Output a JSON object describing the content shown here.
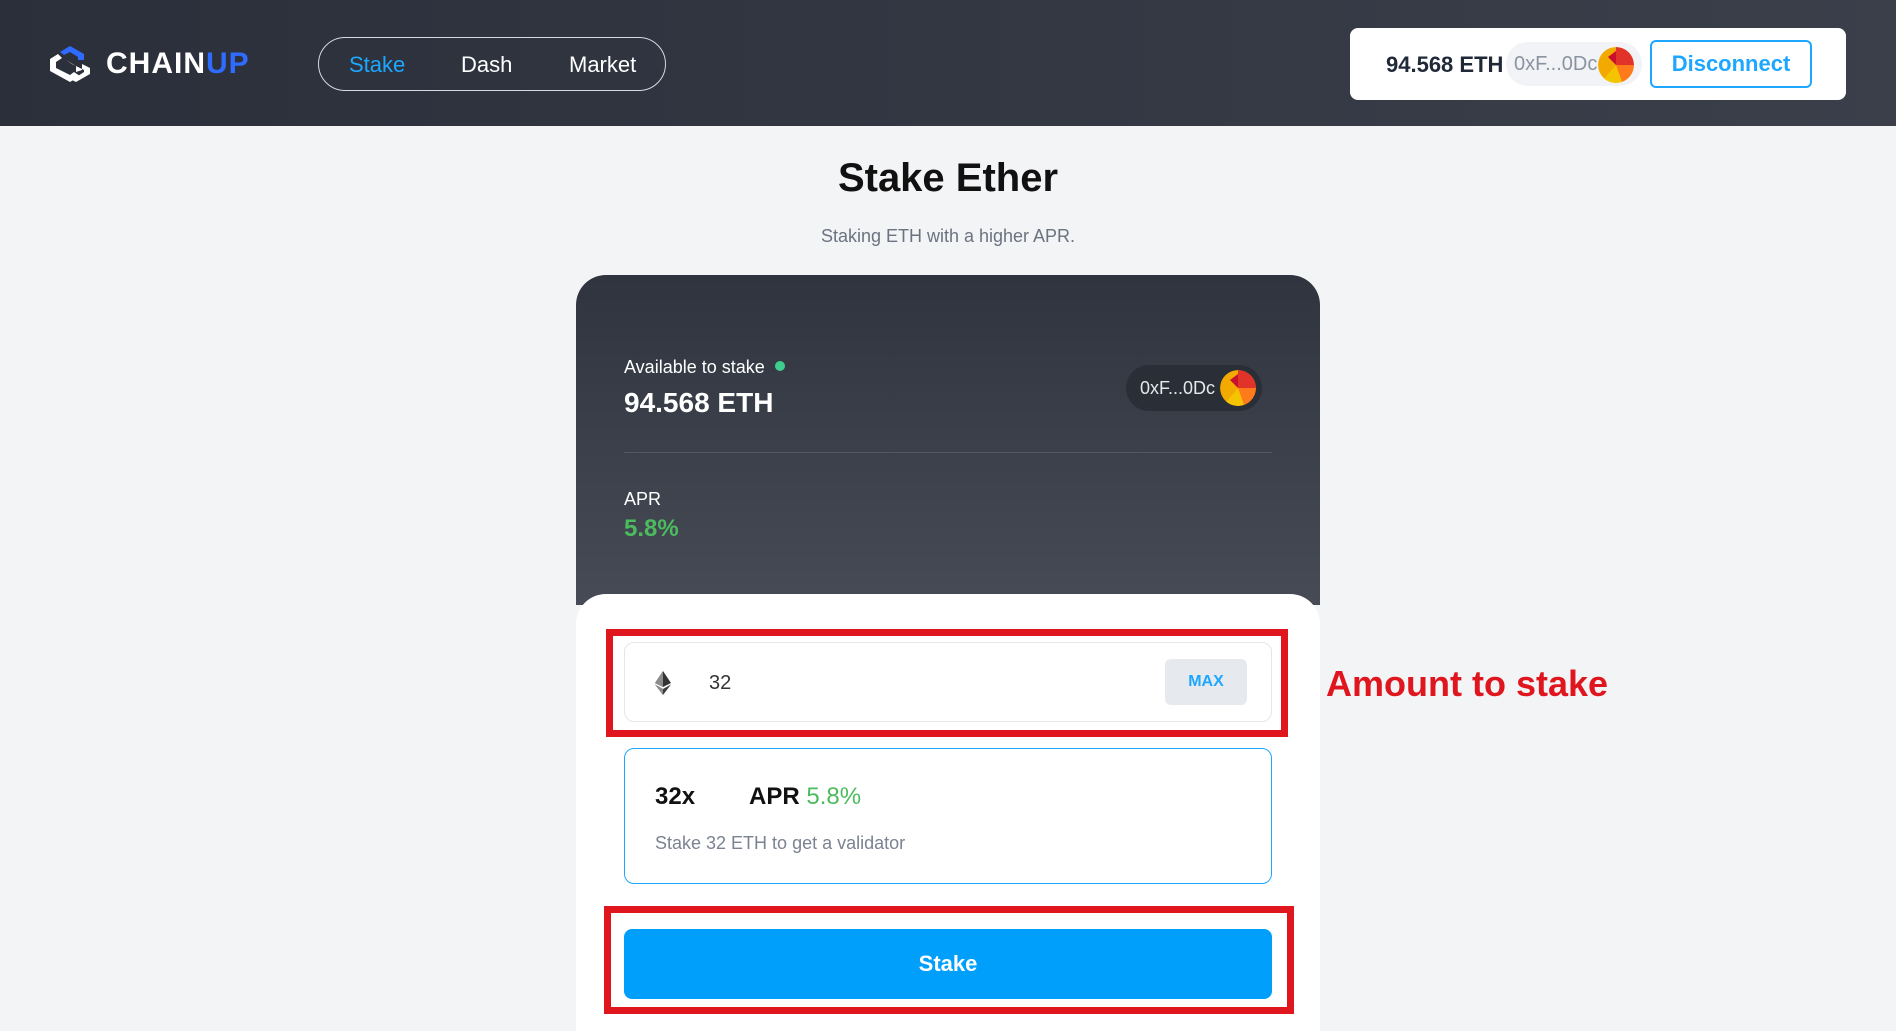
{
  "header": {
    "logo_text_main": "CHAIN",
    "logo_text_accent": "UP",
    "nav": [
      "Stake",
      "Dash",
      "Market"
    ],
    "active_nav": "Stake",
    "wallet": {
      "balance": "94.568 ETH",
      "address": "0xF...0Dc",
      "disconnect_label": "Disconnect"
    }
  },
  "page": {
    "title": "Stake Ether",
    "subtitle": "Staking ETH with a higher APR."
  },
  "summary": {
    "available_label": "Available to stake",
    "available_value": "94.568 ETH",
    "address": "0xF...0Dc",
    "apr_label": "APR",
    "apr_value": "5.8%"
  },
  "form": {
    "amount_value": "32",
    "max_label": "MAX",
    "option_multiplier": "32x",
    "option_apr_label": "APR",
    "option_apr_value": "5.8%",
    "option_description": "Stake 32 ETH to get a validator",
    "stake_button_label": "Stake"
  },
  "annotation": {
    "label": "Amount to stake"
  },
  "colors": {
    "accent": "#1ea7ff",
    "primary_button": "#009ffc",
    "apr_green": "#4cbb5e",
    "annotation_red": "#e0161e",
    "status_dot": "#3ecf8e"
  },
  "icons": [
    "chainup-logo-icon",
    "avatar-icon",
    "ethereum-icon",
    "status-dot-icon"
  ]
}
